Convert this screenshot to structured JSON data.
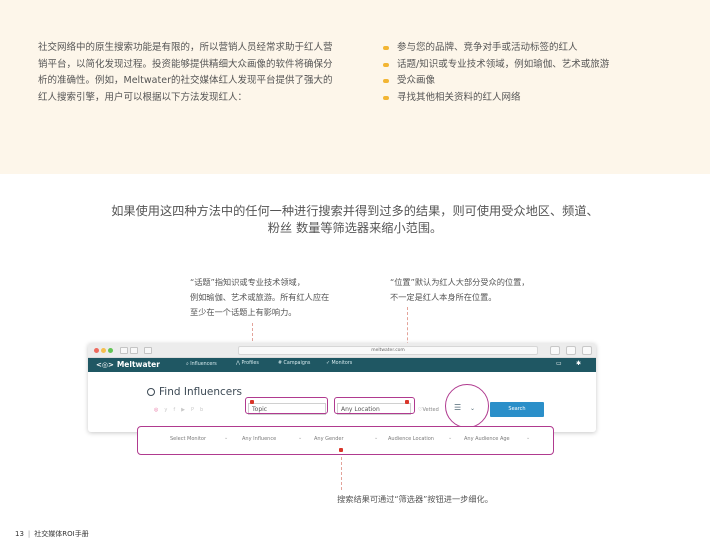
{
  "intro": {
    "lines": [
      "社交网络中的原生搜索功能是有限的，所以营销人员经常求助于红人营",
      "销平台，以简化发现过程。投资能够提供精细大众画像的软件将确保分",
      "析的准确性。例如，Meltwater的社交媒体红人发现平台提供了强大的",
      "红人搜索引擎，用户可以根据以下方法发现红人："
    ]
  },
  "bullets": [
    "参与您的品牌、竞争对手或活动标签的红人",
    "话题/知识或专业技术领域，例如瑜伽、艺术或旅游",
    "受众画像",
    "寻找其他相关资料的红人网络"
  ],
  "headline": {
    "line1": "如果使用这四种方法中的任何一种进行搜索并得到过多的结果，则可使用受众地区、频道、",
    "line2": "粉丝 数量等筛选器来缩小范围。"
  },
  "callouts": {
    "topic": [
      "“话题”指知识或专业技术领域，",
      "例如瑜伽、艺术或旅游。所有红人应在",
      "至少在一个话题上有影响力。"
    ],
    "location": [
      "“位置”默认为红人大部分受众的位置，",
      "不一定是红人本身所在位置。"
    ],
    "filter": "搜索结果可通过“筛选器”按钮进一步细化。"
  },
  "browser": {
    "url": "meltwater.com",
    "brand": "Meltwater",
    "nav": [
      "Influencers",
      "Profiles",
      "Campaigns",
      "Monitors"
    ],
    "page_title": "Find Influencers",
    "topic_placeholder": "Topic",
    "location_value": "Any Location",
    "vetted_label": "Vetted",
    "search_label": "Search",
    "filters": [
      "Select Monitor",
      "Any Influence",
      "Any Gender",
      "Audience Location",
      "Any Audience Age"
    ]
  },
  "footer": {
    "page": "13",
    "separator": "|",
    "title": "社交媒体ROI手册"
  },
  "colors": {
    "band": "#fdf6ea",
    "bullet": "#f2b533",
    "highlight": "#b03a8f",
    "nav": "#1f5763",
    "search": "#2b8fc9",
    "callout_dot": "#d9362a"
  }
}
